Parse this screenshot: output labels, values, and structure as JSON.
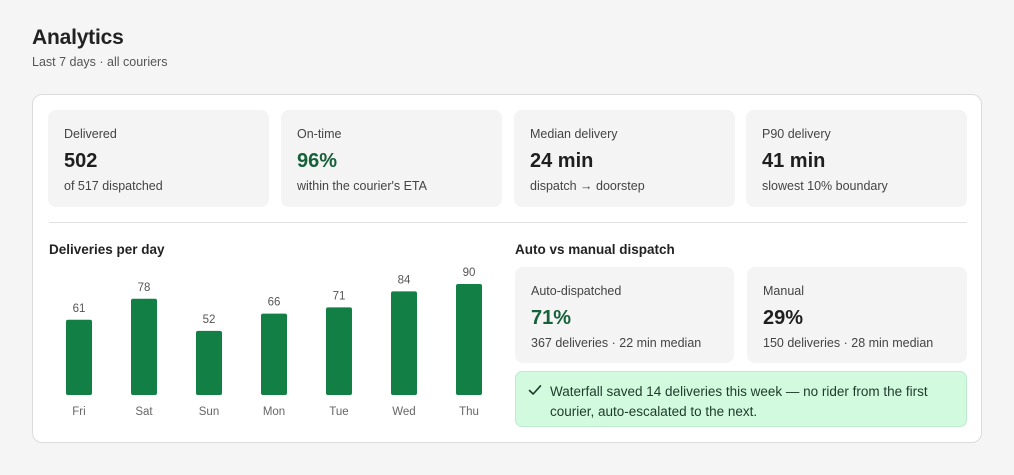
{
  "header": {
    "title": "Analytics",
    "subtitle": "Last 7 days · all couriers"
  },
  "stats": [
    {
      "label": "Delivered",
      "value": "502",
      "sub": "of 517 dispatched",
      "color": "#1f1f1f"
    },
    {
      "label": "On-time",
      "value": "96%",
      "sub": "within the courier's ETA",
      "color": "#16603a"
    },
    {
      "label": "Median delivery",
      "value": "24 min",
      "sub": "dispatch → doorstep",
      "color": "#1f1f1f"
    },
    {
      "label": "P90 delivery",
      "value": "41 min",
      "sub": "slowest 10% boundary",
      "color": "#1f1f1f"
    }
  ],
  "deliveries_chart": {
    "title": "Deliveries per day"
  },
  "chart_data": {
    "type": "bar",
    "title": "Deliveries per day",
    "categories": [
      "Fri",
      "Sat",
      "Sun",
      "Mon",
      "Tue",
      "Wed",
      "Thu"
    ],
    "values": [
      61,
      78,
      52,
      66,
      71,
      84,
      90
    ],
    "xlabel": "",
    "ylabel": "",
    "ylim": [
      0,
      90
    ],
    "grid": false,
    "color": "#127f44"
  },
  "dispatch": {
    "title": "Auto vs manual dispatch",
    "auto": {
      "label": "Auto-dispatched",
      "value": "71%",
      "sub": "367 deliveries · 22 min median",
      "color": "#16603a"
    },
    "manual": {
      "label": "Manual",
      "value": "29%",
      "sub": "150 deliveries · 28 min median",
      "color": "#1f1f1f"
    }
  },
  "callout": {
    "icon": "check-icon",
    "text": "Waterfall saved 14 deliveries this week — no rider from the first courier, auto-escalated to the next.",
    "background": "#d2fadf"
  }
}
